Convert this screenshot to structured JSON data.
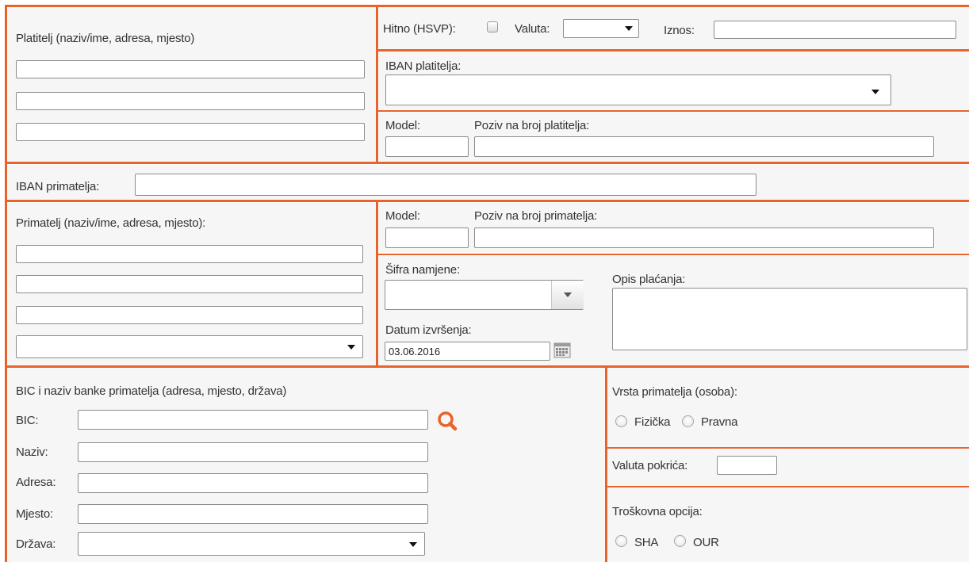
{
  "payer": {
    "title": "Platitelj (naziv/ime, adresa, mjesto)",
    "lines": [
      "",
      "",
      ""
    ]
  },
  "top": {
    "urgent_label": "Hitno (HSVP):",
    "currency_label": "Valuta:",
    "currency_value": "",
    "amount_label": "Iznos:",
    "amount_value": ""
  },
  "payer_iban": {
    "label": "IBAN platitelja:",
    "value": ""
  },
  "payer_ref": {
    "model_label": "Model:",
    "model_value": "",
    "reference_label": "Poziv na broj platitelja:",
    "reference_value": ""
  },
  "recipient_iban": {
    "label": "IBAN primatelja:",
    "value": ""
  },
  "recipient": {
    "title": "Primatelj (naziv/ime, adresa, mjesto):",
    "lines": [
      "",
      "",
      ""
    ],
    "country_value": ""
  },
  "recipient_ref": {
    "model_label": "Model:",
    "model_value": "",
    "reference_label": "Poziv na broj primatelja:",
    "reference_value": ""
  },
  "purpose": {
    "label": "Šifra namjene:",
    "value": ""
  },
  "description": {
    "label": "Opis plaćanja:",
    "value": ""
  },
  "execution_date": {
    "label": "Datum izvršenja:",
    "value": "03.06.2016"
  },
  "bank": {
    "title": "BIC i naziv banke primatelja (adresa, mjesto, država)",
    "bic_label": "BIC:",
    "name_label": "Naziv:",
    "address_label": "Adresa:",
    "city_label": "Mjesto:",
    "country_label": "Država:"
  },
  "recipient_type": {
    "label": "Vrsta primatelja (osoba):",
    "option_natural": "Fizička",
    "option_legal": "Pravna"
  },
  "cover_currency": {
    "label": "Valuta pokrića:",
    "value": ""
  },
  "cost_option": {
    "label": "Troškovna opcija:",
    "option_sha": "SHA",
    "option_our": "OUR"
  },
  "colors": {
    "accent": "#e8632c",
    "background": "#f6f6f6"
  },
  "icons": {
    "search": "search-icon",
    "calendar": "calendar-icon"
  }
}
